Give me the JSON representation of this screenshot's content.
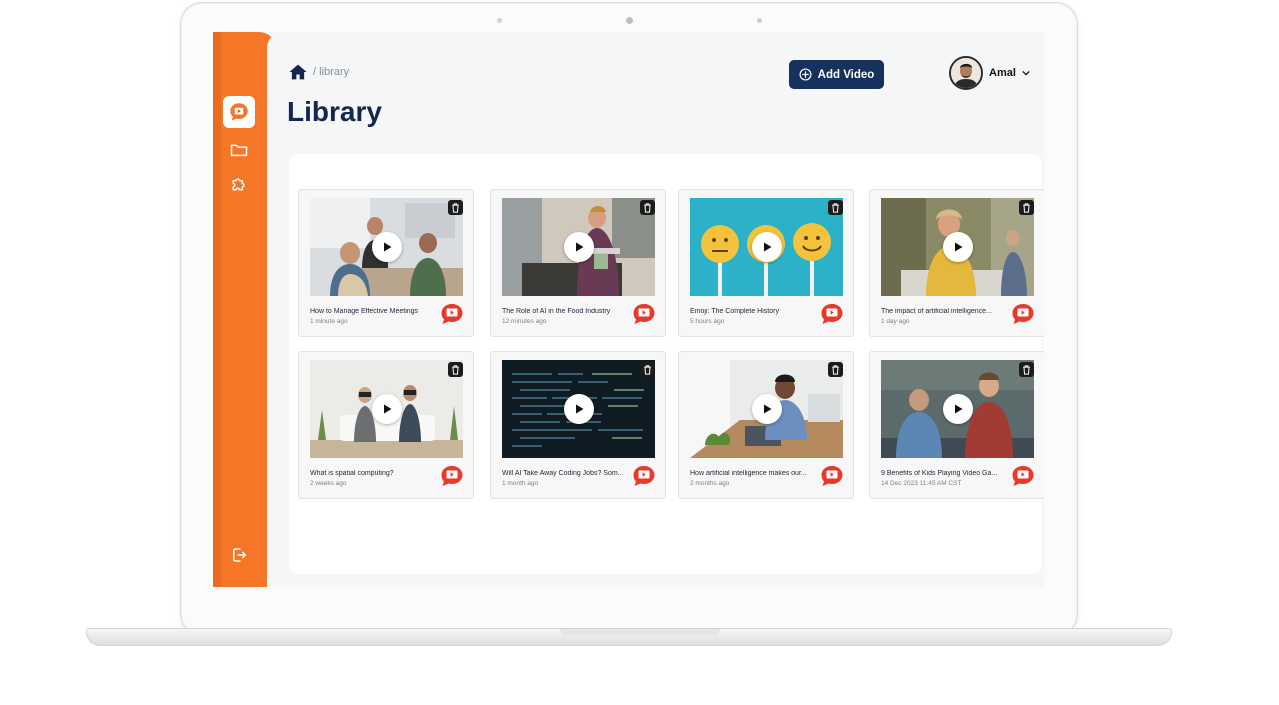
{
  "breadcrumb": {
    "path": "/ library"
  },
  "page": {
    "title": "Library"
  },
  "header": {
    "add_video_label": "Add Video",
    "user_name": "Amal"
  },
  "sidebar": {
    "items": [
      {
        "icon": "video-chat-icon",
        "active": true
      },
      {
        "icon": "folder-icon",
        "active": false
      },
      {
        "icon": "puzzle-icon",
        "active": false
      }
    ],
    "footer_icon": "logout-icon"
  },
  "colors": {
    "sidebar": "#f47626",
    "primary": "#15315c",
    "title": "#14274e",
    "logo_red": "#e8392b"
  },
  "videos": [
    {
      "title": "How to Manage Effective Meetings",
      "time": "1 minute ago"
    },
    {
      "title": "The Role of AI in the Food Industry",
      "time": "12 minutes ago"
    },
    {
      "title": "Emoji: The Complete History",
      "time": "5 hours ago"
    },
    {
      "title": "The impact of artificial intelligence...",
      "time": "1 day ago"
    },
    {
      "title": "What is spatial computing?",
      "time": "2 weeks ago"
    },
    {
      "title": "Will AI Take Away Coding Jobs? Som...",
      "time": "1 month ago"
    },
    {
      "title": "How artificial intelligence makes our...",
      "time": "2 months ago"
    },
    {
      "title": "9 Benefits of Kids Playing Video Ga...",
      "time": "14 Dec 2023 11:45 AM CST"
    }
  ]
}
